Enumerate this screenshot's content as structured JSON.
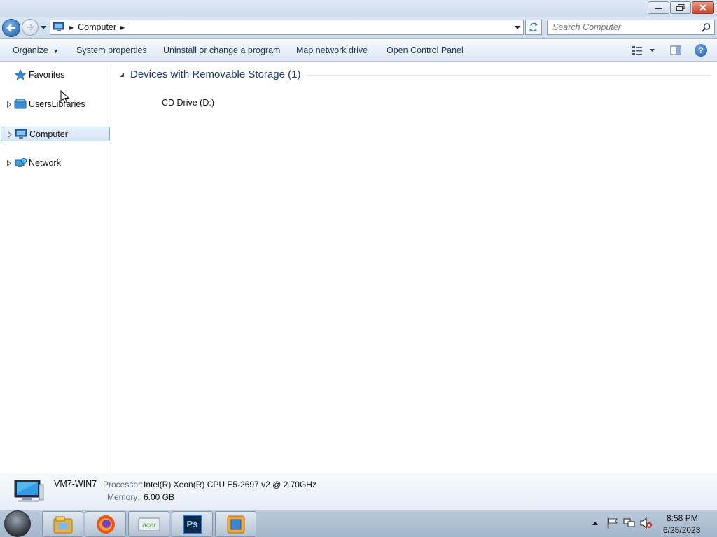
{
  "address_bar": {
    "location": "Computer"
  },
  "search": {
    "placeholder": "Search Computer"
  },
  "command_bar": {
    "organize": "Organize",
    "system_properties": "System properties",
    "uninstall": "Uninstall or change a program",
    "map_network_drive": "Map network drive",
    "open_control_panel": "Open Control Panel"
  },
  "nav_pane": {
    "items": [
      {
        "label": "Favorites"
      },
      {
        "label": "UsersLibraries"
      },
      {
        "label": "Computer",
        "selected": true
      },
      {
        "label": "Network"
      }
    ]
  },
  "content": {
    "group_title": "Devices with Removable Storage (1)",
    "items": [
      {
        "label": "CD Drive (D:)"
      }
    ]
  },
  "details": {
    "pc_name": "VM7-WIN7",
    "processor_label": "Processor:",
    "processor_value": "Intel(R) Xeon(R) CPU E5-2697 v2 @ 2.70GHz",
    "memory_label": "Memory:",
    "memory_value": "6.00 GB"
  },
  "taskbar": {
    "apps": [
      "windows-explorer-icon",
      "firefox-icon",
      "acer-icon",
      "photoshop-icon",
      "app-icon"
    ],
    "ps_label": "Ps"
  },
  "clock": {
    "time": "8:58 PM",
    "date": "6/25/2023"
  },
  "colors": {
    "accent": "#1e3a6e",
    "selection": "#d4e5f8",
    "titlebar": "#dfe9f5",
    "taskbar": "#a4b6cb"
  }
}
